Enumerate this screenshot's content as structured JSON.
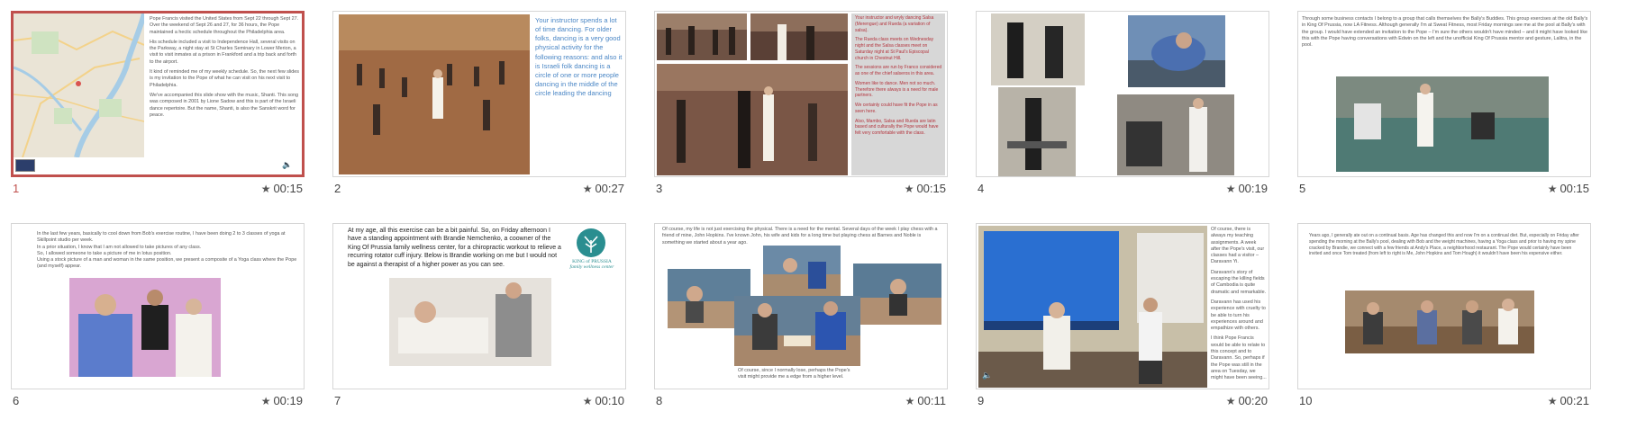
{
  "slides": [
    {
      "number": "1",
      "duration": "00:15",
      "selected": true,
      "text": [
        "Pope Francis visited the United States from Sept 22 through Sept 27. Over the weekend of Sept 26 and 27, for 36 hours, the Pope maintained a hectic schedule throughout the Philadelphia area.",
        "His schedule included a visit to Independence Hall, several visits on the Parkway, a night stay at St Charles Seminary in Lower Merion, a visit to visit inmates at a prison in Frankford and a trip back and forth to the airport.",
        "It kind of reminded me of my weekly schedule. So, the next few slides is my invitation to the Pope of what he can visit on his next visit to Philadelphia.",
        "We've accompanied this slide show with the music, Shanti. This song was composed in 2001 by Lione Sadow and this is part of the Israeli dance repertoire. But the name, Shanti, is also the Sanskrit word for peace."
      ]
    },
    {
      "number": "2",
      "duration": "00:27",
      "text": [
        "Your instructor spends a lot of time dancing. For older folks, dancing is a very good physical activity for the following reasons: and also it is Israeli folk dancing is a circle of one or more people dancing in the middle of the circle leading the dancing"
      ]
    },
    {
      "number": "3",
      "duration": "00:15",
      "text": [
        "Your instructor and wryly dancing Salsa (Merengue) and Rueda (a variation of salsa).",
        "The Rueda class meets on Wednesday night and the Salsa classes meet on Saturday night at St Paul's Episcopal church in Chestnut Hill.",
        "The sessions are run by Franco considered as one of the chief salseros in this area.",
        "Women like to dance. Men not so much. Therefore there always is a need for male partners.",
        "We certainly could have fit the Pope in as seen here.",
        "Also, Mambo, Salsa and Rueda are latin based and culturally the Pope would have felt very comfortable with the class."
      ]
    },
    {
      "number": "4",
      "duration": "00:19",
      "text": []
    },
    {
      "number": "5",
      "duration": "00:15",
      "text": [
        "Through some business contacts I belong to a group that calls themselves the Bally's Buddies. This group exercises at the old Bally's in King Of Prussia, now LA Fitness. Although generally I'm at Sweat Fitness, most Friday mornings see me at the pool at Bally's with the group. I would have extended an invitation to the Pope – I'm sure the others wouldn't have minded – and it might have looked like this with the Pope having conversations with Edwin on the left and the unofficial King Of Prussia mentor and gesture, Lalitra, in the pool."
      ]
    },
    {
      "number": "6",
      "duration": "00:19",
      "text": [
        "In the last few years, basically to cool down from Bob's exercise routine, I have been doing 2 to 3 classes of yoga at Skillpoint studio per week.",
        "In a prior situation, I know that I am not allowed to take pictures of any class.",
        "So, I allowed someone to take a picture of me in lotus position.",
        "Using a stock picture of a man and woman in the same position, we present a composite of a Yoga class where the Pope (and myself) appear."
      ]
    },
    {
      "number": "7",
      "duration": "00:10",
      "text": [
        "At my age, all this exercise can be a bit painful. So, on Friday afternoon I have a standing appointment with Brandie Nemchenko, a coowner of the King Of Prussia family wellness center, for a chiropractic workout to relieve a recurring rotator cuff injury. Below is Brandie working on me but I would not be against a therapist of a higher power as you can see."
      ],
      "logo_line1": "KING of PRUSSIA",
      "logo_line2": "family wellness center"
    },
    {
      "number": "8",
      "duration": "00:11",
      "text": [
        "Of course, my life is not just exercising the physical. There is a need for the mental. Several days of the week I play chess with a friend of mine, John Hopkins. I've known John, his wife and kids for a long time but playing chess at Barnes and Noble is something we started about a year ago.",
        "Of course, since I normally lose, perhaps the Pope's visit might provide me a edge from a higher level."
      ]
    },
    {
      "number": "9",
      "duration": "00:20",
      "text": [
        "Of course, there is always my teaching assignments. A week after the Pope's visit, our classes had a visitor – Daravann Yi.",
        "Daravann's story of escaping the killing fields of Cambodia is quite dramatic and remarkable.",
        "Daravann has used his experience with cruelty to be able to turn his experiences around and empathize with others.",
        "I think Pope Francis would be able to relate to this concept and to Daravann. So, perhaps if the Pope was still in the area on Tuesday, we might have been seeing..."
      ]
    },
    {
      "number": "10",
      "duration": "00:21",
      "text": [
        "Years ago, I generally ate out on a continual basis. Age has changed this and now I'm on a continual diet. But, especially on Friday after spending the morning at the Bally's pool, dealing with Bob and the weight machines, having a Yoga class and prior to having my spine cracked by Brandie, we connect with a few friends at Andy's Place, a neighborhood restaurant. The Pope would certainly have been invited and once Tom treated (from left to right is Me, John Hopkins and Tom Hough) it wouldn't have been his expensive either."
      ]
    }
  ]
}
